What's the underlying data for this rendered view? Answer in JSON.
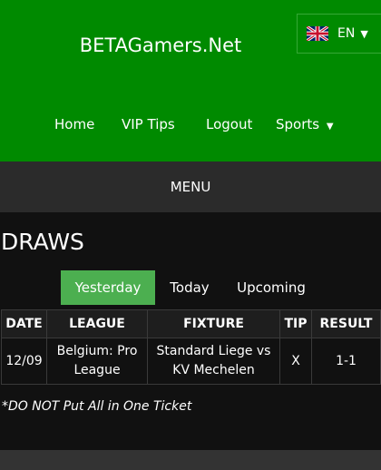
{
  "header": {
    "site_title": "BETAGamers.Net",
    "language": {
      "code": "EN",
      "flag": "uk-flag-icon"
    },
    "nav": [
      {
        "label": "Home"
      },
      {
        "label": "VIP Tips"
      },
      {
        "label": "Logout"
      },
      {
        "label": "Sports"
      }
    ]
  },
  "menu_label": "MENU",
  "page": {
    "heading": "DRAWS",
    "tabs": [
      {
        "label": "Yesterday",
        "active": true
      },
      {
        "label": "Today",
        "active": false
      },
      {
        "label": "Upcoming",
        "active": false
      }
    ],
    "table": {
      "columns": [
        "DATE",
        "LEAGUE",
        "FIXTURE",
        "TIP",
        "RESULT"
      ],
      "rows": [
        {
          "date": "12/09",
          "league": "Belgium: Pro League",
          "fixture": "Standard Liege vs KV Mechelen",
          "tip": "X",
          "result": "1-1"
        }
      ]
    },
    "note": "*DO NOT Put All in One Ticket"
  },
  "colors": {
    "header_green": "#008a00",
    "active_tab": "#4caf50",
    "menu_bar": "#2b2b2b",
    "background": "#111111"
  }
}
